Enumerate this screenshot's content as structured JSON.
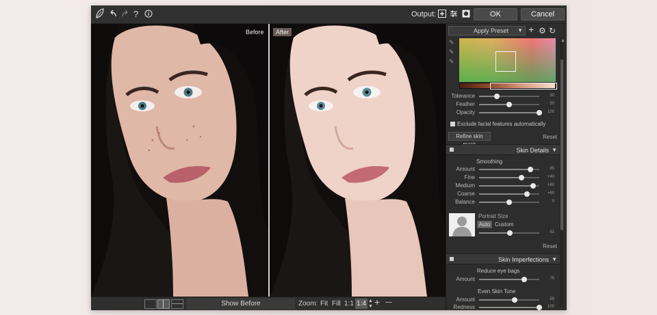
{
  "topbar": {
    "logo_icon": "leaf-logo-icon",
    "undo_icon": "undo-icon",
    "redo_icon": "redo-icon",
    "help_label": "?",
    "info_icon": "info-icon",
    "output_label": "Output:",
    "ok_label": "OK",
    "cancel_label": "Cancel"
  },
  "viewer": {
    "before_label": "Before",
    "after_label": "After"
  },
  "bottombar": {
    "show_before_label": "Show Before",
    "zoom_label": "Zoom:",
    "fit_label": "Fit",
    "fill_label": "Fill",
    "ratio_label": "1:1",
    "zoom_value": "1:4",
    "plus_label": "+",
    "minus_label": "—"
  },
  "panel": {
    "apply_preset_label": "Apply Preset",
    "mask": {
      "sliders": [
        {
          "label": "Tolerance",
          "value": 30,
          "fraction": 0.3
        },
        {
          "label": "Feather",
          "value": 50,
          "fraction": 0.5
        },
        {
          "label": "Opacity",
          "value": 100,
          "fraction": 1.0
        }
      ],
      "exclude_label": "Exclude facial features automatically",
      "refine_label": "Refine skin mask",
      "reset_label": "Reset"
    },
    "skin_details": {
      "title": "Skin Details",
      "smoothing_label": "Smoothing",
      "sliders": [
        {
          "label": "Amount",
          "value": "85",
          "fraction": 0.85
        },
        {
          "label": "Fine",
          "value": "+40",
          "fraction": 0.7
        },
        {
          "label": "Medium",
          "value": "+80",
          "fraction": 0.9
        },
        {
          "label": "Coarse",
          "value": "+60",
          "fraction": 0.8
        },
        {
          "label": "Balance",
          "value": "0",
          "fraction": 0.5
        }
      ],
      "portrait_size_label": "Portrait Size",
      "auto_label": "Auto",
      "custom_label": "Custom",
      "portrait_value": "51",
      "portrait_fraction": 0.51,
      "reset_label": "Reset"
    },
    "skin_imperfections": {
      "title": "Skin Imperfections",
      "eye_bags_label": "Reduce eye bags",
      "eye_amount_label": "Amount",
      "eye_amount_value": "75",
      "eye_amount_fraction": 0.75,
      "even_tone_label": "Even Skin Tone",
      "tone_amount_label": "Amount",
      "tone_amount_value": "59",
      "tone_amount_fraction": 0.59,
      "redness_label": "Redness",
      "redness_value": "100",
      "redness_fraction": 1.0
    }
  },
  "colors": {
    "app_bg": "#2b2b2b",
    "panel_bg": "#2d2d2d",
    "header_bg": "#383838",
    "after_tag_bg": "#6b5c57"
  }
}
